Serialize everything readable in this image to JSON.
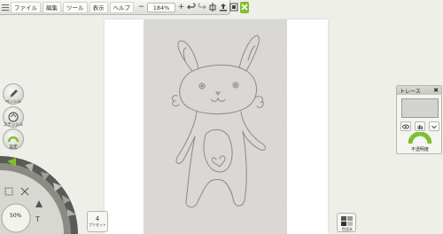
{
  "toolbar": {
    "menu_items": [
      "ファイル",
      "編集",
      "ツール",
      "表示",
      "ヘルプ"
    ],
    "zoom_minus": "−",
    "zoom_value": "184%",
    "zoom_plus": "+",
    "icons": [
      "menu-icon",
      "undo-icon",
      "redo-icon",
      "symmetry-icon",
      "upload-icon",
      "trace-image-icon",
      "close-app-icon"
    ]
  },
  "left_panel": {
    "tool_labels": [
      "ペンシル",
      "ステンシル",
      "設定"
    ],
    "brush_size": "50%",
    "preset_count": "4",
    "preset_label": "プリセット"
  },
  "trace_panel": {
    "title": "トレース",
    "close": "✖",
    "opacity_label": "不透明度",
    "opacity_value": "50%"
  },
  "color_panel": {
    "color_set_label": "色見本"
  },
  "colors": {
    "accent_green": "#7fbf2e",
    "background": "#efefea",
    "paper": "#ffffff"
  }
}
